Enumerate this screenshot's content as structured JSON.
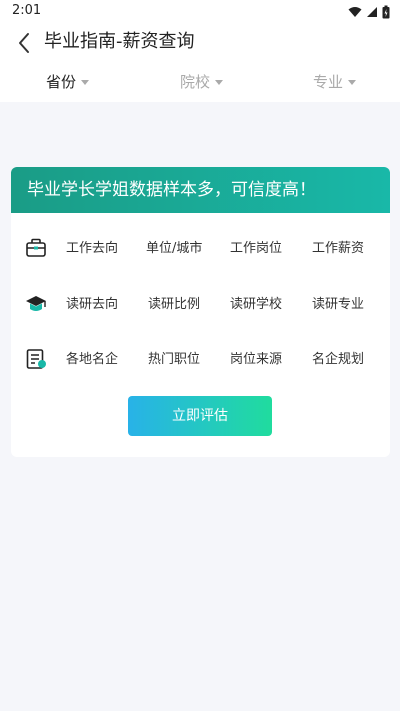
{
  "status": {
    "time": "2:01"
  },
  "header": {
    "title": "毕业指南-薪资查询"
  },
  "filters": [
    {
      "label": "省份"
    },
    {
      "label": "院校"
    },
    {
      "label": "专业"
    }
  ],
  "card": {
    "banner": "毕业学长学姐数据样本多，可信度高！",
    "rows": [
      {
        "icon": "briefcase-icon",
        "items": [
          "工作去向",
          "单位/城市",
          "工作岗位",
          "工作薪资"
        ]
      },
      {
        "icon": "graduation-cap-icon",
        "items": [
          "读研去向",
          "读研比例",
          "读研学校",
          "读研专业"
        ]
      },
      {
        "icon": "report-icon",
        "items": [
          "各地名企",
          "热门职位",
          "岗位来源",
          "名企规划"
        ]
      }
    ],
    "button": "立即评估"
  },
  "colors": {
    "banner_start": "#1a9c86",
    "banner_end": "#19b8a8",
    "button_start": "#28b2e8",
    "button_end": "#20dc9e",
    "background": "#f5f6fa"
  }
}
